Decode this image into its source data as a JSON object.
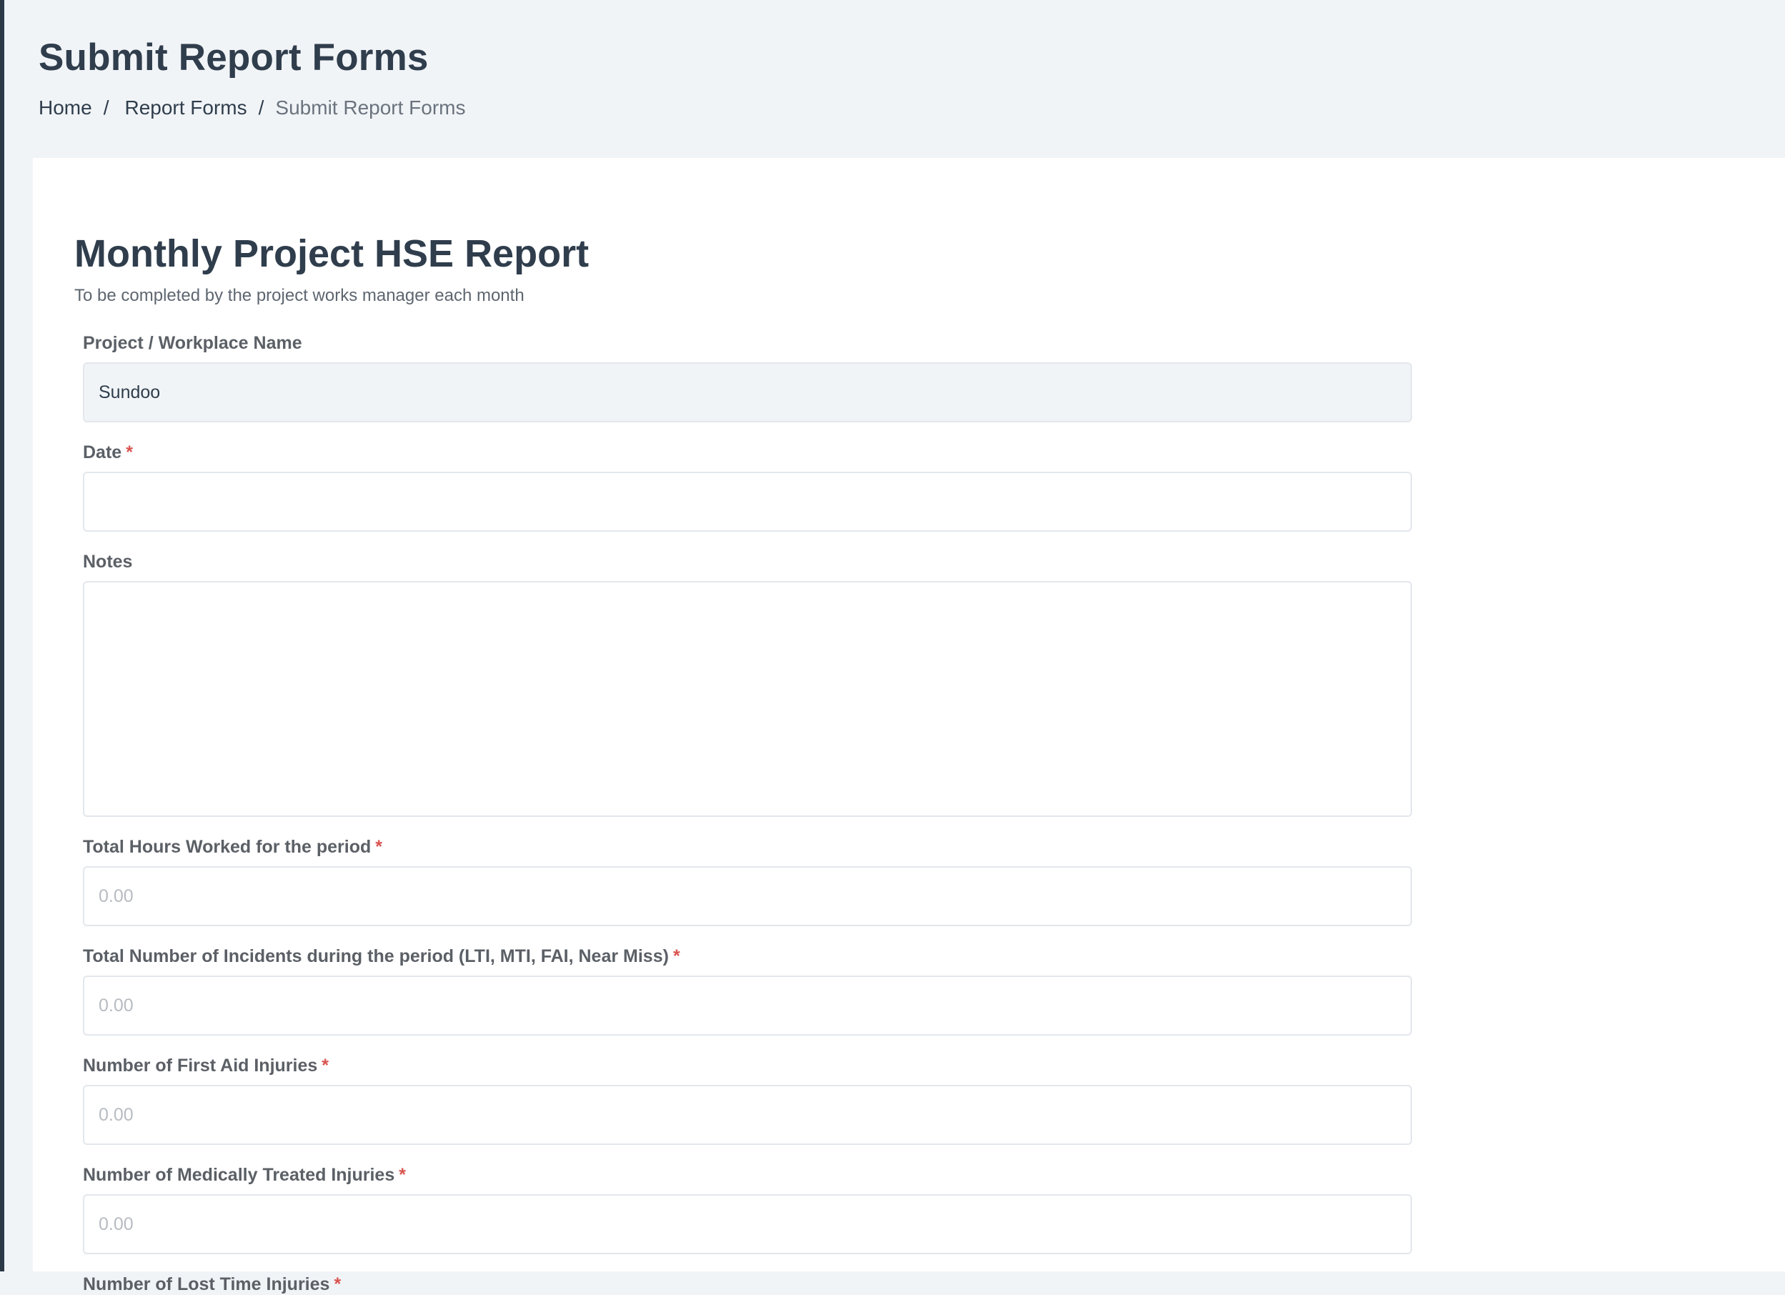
{
  "page": {
    "title": "Submit Report Forms",
    "breadcrumb": [
      "Home",
      "Report Forms",
      "Submit Report Forms"
    ],
    "breadcrumb_separator": "/"
  },
  "form": {
    "title": "Monthly Project HSE Report",
    "subtitle": "To be completed by the project works manager each month",
    "required_marker": "*",
    "fields": {
      "project_name": {
        "label": "Project / Workplace Name",
        "value": "Sundoo"
      },
      "date": {
        "label": "Date",
        "value": ""
      },
      "notes": {
        "label": "Notes",
        "value": ""
      },
      "total_hours": {
        "label": "Total Hours Worked for the period",
        "placeholder": "0.00"
      },
      "total_incidents": {
        "label": "Total Number of Incidents during the period (LTI, MTI, FAI, Near Miss)",
        "placeholder": "0.00"
      },
      "first_aid": {
        "label": "Number of First Aid Injuries",
        "placeholder": "0.00"
      },
      "medically_treated": {
        "label": "Number of Medically Treated Injuries",
        "placeholder": "0.00"
      },
      "lost_time": {
        "label": "Number of Lost Time Injuries"
      }
    }
  },
  "colors": {
    "background": "#f1f4f7",
    "card": "#ffffff",
    "heading": "#2f3d4c",
    "required": "#d9534f",
    "left_rail": "#2b3947"
  }
}
